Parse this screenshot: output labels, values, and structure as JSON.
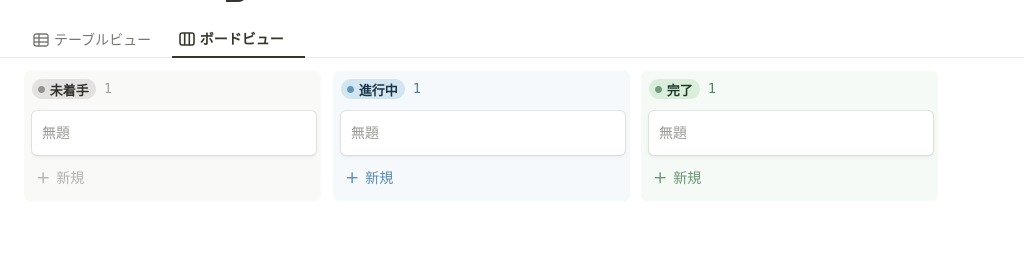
{
  "tabs": [
    {
      "label": "テーブルビュー",
      "icon": "table-icon"
    },
    {
      "label": "ボードビュー",
      "icon": "board-icon",
      "active": true
    }
  ],
  "columns": [
    {
      "status": "未着手",
      "count": "1",
      "card_title": "無題",
      "new_label": "新規",
      "colors": {
        "pill_bg": "#e3e2e0",
        "dot": "#91918e",
        "column_bg": "#f9f9f8"
      }
    },
    {
      "status": "進行中",
      "count": "1",
      "card_title": "無題",
      "new_label": "新規",
      "colors": {
        "pill_bg": "#d3e5ef",
        "dot": "#5b97bd",
        "column_bg": "#f5f9fc"
      }
    },
    {
      "status": "完了",
      "count": "1",
      "card_title": "無題",
      "new_label": "新規",
      "colors": {
        "pill_bg": "#dbeddb",
        "dot": "#6c9b7d",
        "column_bg": "#f6faf6"
      }
    }
  ],
  "icons": {
    "plus": "+"
  }
}
